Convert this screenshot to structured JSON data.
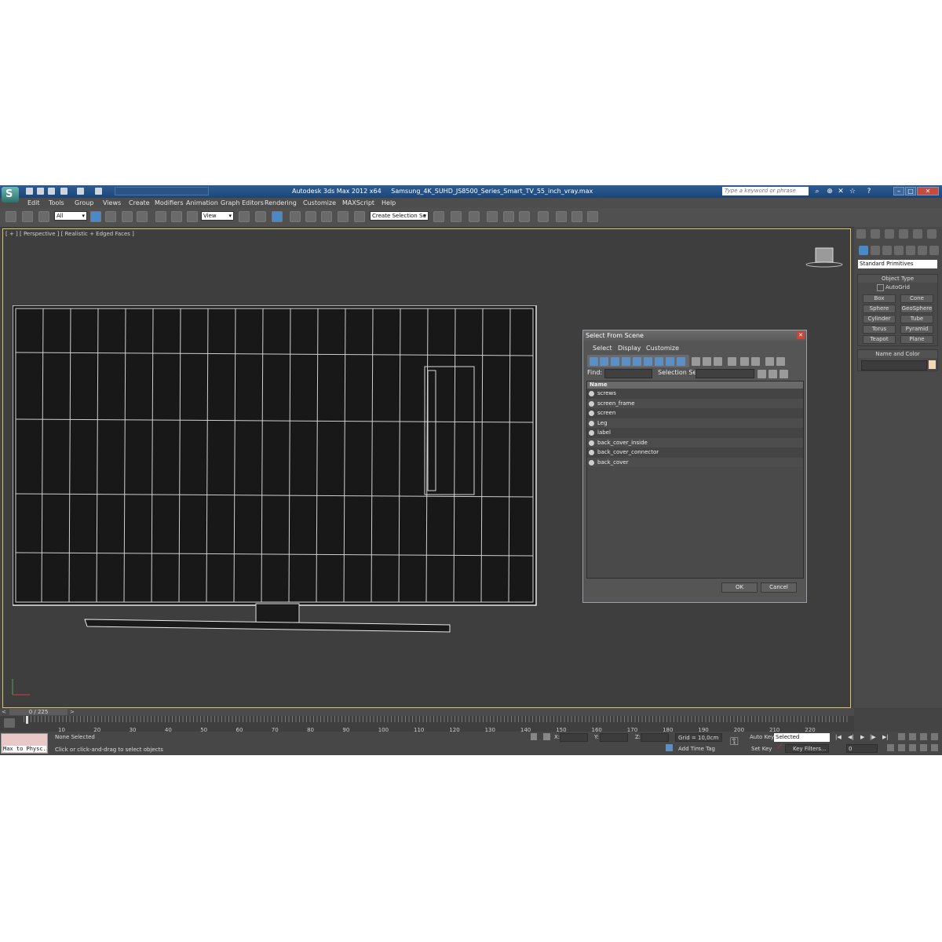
{
  "app": {
    "title": "Autodesk 3ds Max  2012 x64",
    "file": "Samsung_4K_SUHD_JS8500_Series_Smart_TV_55_inch_vray.max",
    "search_placeholder": "Type a keyword or phrase"
  },
  "menu": [
    "Edit",
    "Tools",
    "Group",
    "Views",
    "Create",
    "Modifiers",
    "Animation",
    "Graph Editors",
    "Rendering",
    "Customize",
    "MAXScript",
    "Help"
  ],
  "toolbar": {
    "selection_filter": "All",
    "reference_coord": "View",
    "named_selection": "Create Selection Se"
  },
  "viewport": {
    "label": "[ + ] [ Perspective ] [ Realistic + Edged Faces ]"
  },
  "command_panel": {
    "category_dropdown": "Standard Primitives",
    "object_type_title": "Object Type",
    "autogrid_label": "AutoGrid",
    "primitives": [
      "Box",
      "Cone",
      "Sphere",
      "GeoSphere",
      "Cylinder",
      "Tube",
      "Torus",
      "Pyramid",
      "Teapot",
      "Plane"
    ],
    "name_color_title": "Name and Color"
  },
  "dialog": {
    "title": "Select From Scene",
    "menu": [
      "Select",
      "Display",
      "Customize"
    ],
    "find_label": "Find:",
    "selection_set_label": "Selection Set:",
    "column_header": "Name",
    "items": [
      "screws",
      "screen_frame",
      "screen",
      "Leg",
      "label",
      "back_cover_inside",
      "back_cover_connector",
      "back_cover"
    ],
    "ok": "OK",
    "cancel": "Cancel"
  },
  "timeline": {
    "frame_counter": "0 / 225",
    "ticks": [
      "10",
      "20",
      "30",
      "40",
      "50",
      "60",
      "70",
      "80",
      "90",
      "100",
      "110",
      "120",
      "130",
      "140",
      "150",
      "160",
      "170",
      "180",
      "190",
      "200",
      "210",
      "220"
    ]
  },
  "status": {
    "maxscript_listener": "Max to Physc.",
    "selection_status": "None Selected",
    "prompt": "Click or click-and-drag to select objects",
    "x_label": "X:",
    "y_label": "Y:",
    "z_label": "Z:",
    "grid": "Grid = 10,0cm",
    "add_time_tag": "Add Time Tag",
    "auto_key": "Auto Key",
    "set_key": "Set Key",
    "key_mode": "Selected",
    "key_filters": "Key Filters...",
    "current_frame": "0"
  }
}
